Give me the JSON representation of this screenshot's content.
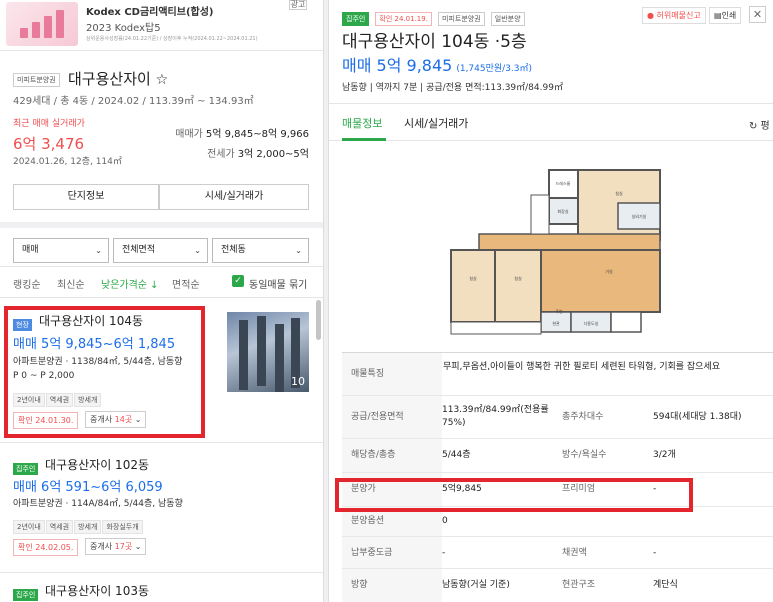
{
  "ad": {
    "title": "Kodex CD금리액티브(합성)",
    "subtitle": "2023 Kodex탑5",
    "note": "상위운용사성장률(24.01.22기준) / 상장이후 누적(2024.01.22~2024.01.21)",
    "close": "광고"
  },
  "summary": {
    "tag": "미피트분양권",
    "name": "대구용산자이",
    "star": "☆",
    "info": "429세대 / 총 4동 / 2024.02 / 113.39㎡ ~ 134.93㎡",
    "recent_label": "최근 매매 실거래가",
    "recent_price": "6억 3,476",
    "recent_date": "2024.01.26, 12층, 114㎡",
    "sale_label": "매매가",
    "sale_range": "5억 9,845~8억 9,966",
    "lease_label": "전세가",
    "lease_range": "3억 2,000~5억",
    "btn_info": "단지정보",
    "btn_price": "시세/실거래가"
  },
  "filters": {
    "deal": "매매",
    "area": "전체면적",
    "dong": "전체동",
    "caret": "⌄"
  },
  "sorts": {
    "items": [
      "랭킹순",
      "최신순",
      "낮은가격순 ↓",
      "면적순"
    ],
    "same_label": "동일매물 묶기",
    "check": "✓"
  },
  "listings": [
    {
      "tag": "현장",
      "name": "대구용산자이 104동",
      "price": "매매 5억 9,845~6억 1,845",
      "info": "아파트분양권 · 1138/84㎡, 5/44층, 남동향",
      "sub": "P 0 ~ P 2,000",
      "chips": [
        "2년이내",
        "역세권",
        "방세개"
      ],
      "confirm": "확인 24.01.30.",
      "broker_label": "중개사",
      "broker_count": "14곳",
      "photo_count": "10"
    },
    {
      "tag": "집주인",
      "name": "대구용산자이 102동",
      "price": "매매 6억 591~6억 6,059",
      "info": "아파트분양권 · 114A/84㎡, 5/44층, 남동향",
      "chips": [
        "2년이내",
        "역세권",
        "방세개",
        "화장실두개"
      ],
      "confirm": "확인 24.02.05.",
      "broker_label": "중개사",
      "broker_count": "17곳"
    },
    {
      "tag": "집주인",
      "name": "대구용산자이 103동"
    }
  ],
  "detail": {
    "tags": [
      "집주인",
      "확인 24.01.19.",
      "미피트분양권",
      "일반분양"
    ],
    "report": "허위매물신고",
    "print": "인쇄",
    "close": "✕",
    "title": "대구용산자이 104동 ·5층",
    "price": "매매 5억 9,845",
    "price_unit": "(1,745만원/3.3㎡)",
    "info": "남동향  |  역까지 7분  |  공급/전용 면적:113.39㎡/84.99㎡",
    "tab_info": "매물정보",
    "tab_price": "시세/실거래가",
    "refresh": "↻ 평",
    "plan_labels": [
      "드레스룸",
      "침실",
      "화장실",
      "침실",
      "침실",
      "거실",
      "주방",
      "다용도실",
      "현관",
      "실외기실"
    ],
    "rows": [
      {
        "label": "매물특징",
        "value": "무피,무옵션,아이들이 행복한 귀한 필로티 세련된 타워형, 기회를 잡으세요"
      },
      {
        "label": "공급/전용면적",
        "value": "113.39㎡/84.99㎡(전용률75%)",
        "label2": "총주차대수",
        "value2": "594대(세대당 1.38대)"
      },
      {
        "label": "해당층/총층",
        "value": "5/44층",
        "label2": "방수/욕실수",
        "value2": "3/2개"
      },
      {
        "label": "분양가",
        "value": "5억9,845",
        "label2": "프리미엄",
        "value2": "-"
      },
      {
        "label": "분양옵션",
        "value": "0"
      },
      {
        "label": "납부중도금",
        "value": "-",
        "label2": "채권액",
        "value2": "-"
      },
      {
        "label": "방향",
        "value": "남동향(거실 기준)",
        "label2": "현관구조",
        "value2": "계단식"
      }
    ]
  }
}
